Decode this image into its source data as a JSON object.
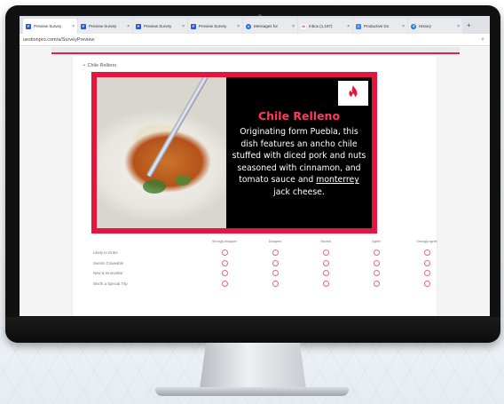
{
  "browser": {
    "tabs": [
      {
        "title": "Preview Survey",
        "icon": "survey-icon",
        "color": "#2f55d4",
        "active": true
      },
      {
        "title": "Preview Survey",
        "icon": "survey-icon",
        "color": "#2f55d4"
      },
      {
        "title": "Preview Survey",
        "icon": "survey-icon",
        "color": "#2f55d4"
      },
      {
        "title": "Preview Survey",
        "icon": "survey-icon",
        "color": "#2f55d4"
      },
      {
        "title": "Messages for",
        "icon": "messages-icon",
        "color": "#1a73e8"
      },
      {
        "title": "Inbox (1,197)",
        "icon": "gmail-icon",
        "color": "#d93025"
      },
      {
        "title": "Productive Do",
        "icon": "docs-icon",
        "color": "#4285f4"
      },
      {
        "title": "History",
        "icon": "history-icon",
        "color": "#1a73e8"
      }
    ],
    "url": "uestionpro.com/a/SurveyPreview"
  },
  "question": {
    "label": "Chile Relleno"
  },
  "hero": {
    "title": "Chile Relleno",
    "desc_before": "Originating form Puebla, this dish features an ancho chile stuffed with diced pork and nuts seasoned with cinnamon, and tomato sauce and ",
    "desc_underlined": "monterrey",
    "desc_after": " jack cheese.",
    "logo_icon": "flame-icon",
    "accent": "#e4163f"
  },
  "likert": {
    "columns": [
      "Strongly disagree",
      "Disagree",
      "Neutral",
      "Agree",
      "Strongly agree"
    ],
    "rows": [
      "Likely to Order",
      "Seems Craveable",
      "New & Innovative",
      "Worth a Special Trip"
    ]
  }
}
